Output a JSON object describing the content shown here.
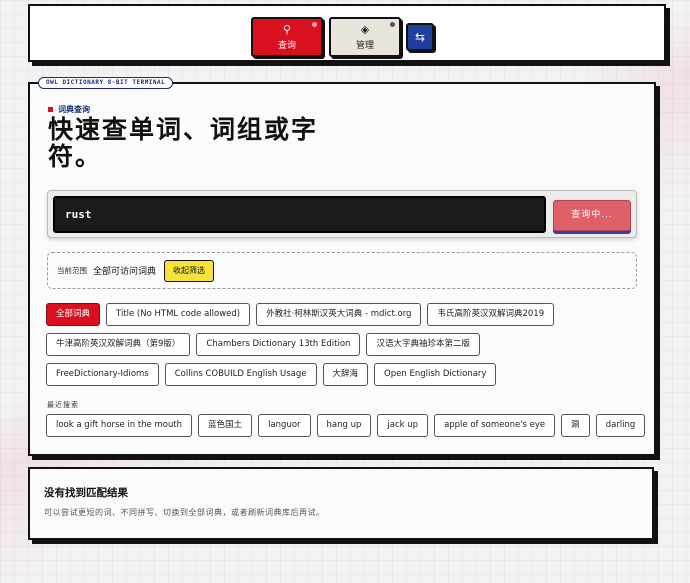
{
  "nav": {
    "search_label": "查询",
    "manage_label": "管理",
    "search_icon": "magnifier-icon",
    "manage_icon": "layers-icon",
    "settings_icon": "sliders-icon"
  },
  "terminal_tag": "OWL DICTIONARY 8-BIT TERMINAL",
  "kicker": "词典查询",
  "headline": "快速查单词、词组或字符。",
  "search": {
    "value": "rust",
    "button_label": "查询中..."
  },
  "scope": {
    "label": "当前范围",
    "value": "全部可访问词典",
    "collapse_label": "收起筛选"
  },
  "dictionaries": [
    [
      "全部词典",
      "Title (No HTML code allowed)",
      "外教社·柯林斯汉英大词典 - mdict.org",
      "韦氏高阶英汉双解词典2019"
    ],
    [
      "牛津高阶英汉双解词典（第9版）",
      "Chambers Dictionary 13th Edition",
      "汉语大字典袖珍本第二版"
    ],
    [
      "FreeDictionary-Idioms",
      "Collins COBUILD English Usage",
      "大辞海",
      "Open English Dictionary"
    ]
  ],
  "recent_label": "最近搜索",
  "recent": [
    "look a gift horse in the mouth",
    "蓝色国土",
    "languor",
    "hang up",
    "jack up",
    "apple of someone's eye",
    "涮",
    "darling"
  ],
  "empty": {
    "title": "没有找到匹配结果",
    "description": "可以尝试更短的词、不同拼写、切换到全部词典，或者刷新词典库后再试。"
  },
  "colors": {
    "accent_red": "#d9101e",
    "accent_blue": "#1f3f9e",
    "accent_yellow": "#f7e23b"
  }
}
